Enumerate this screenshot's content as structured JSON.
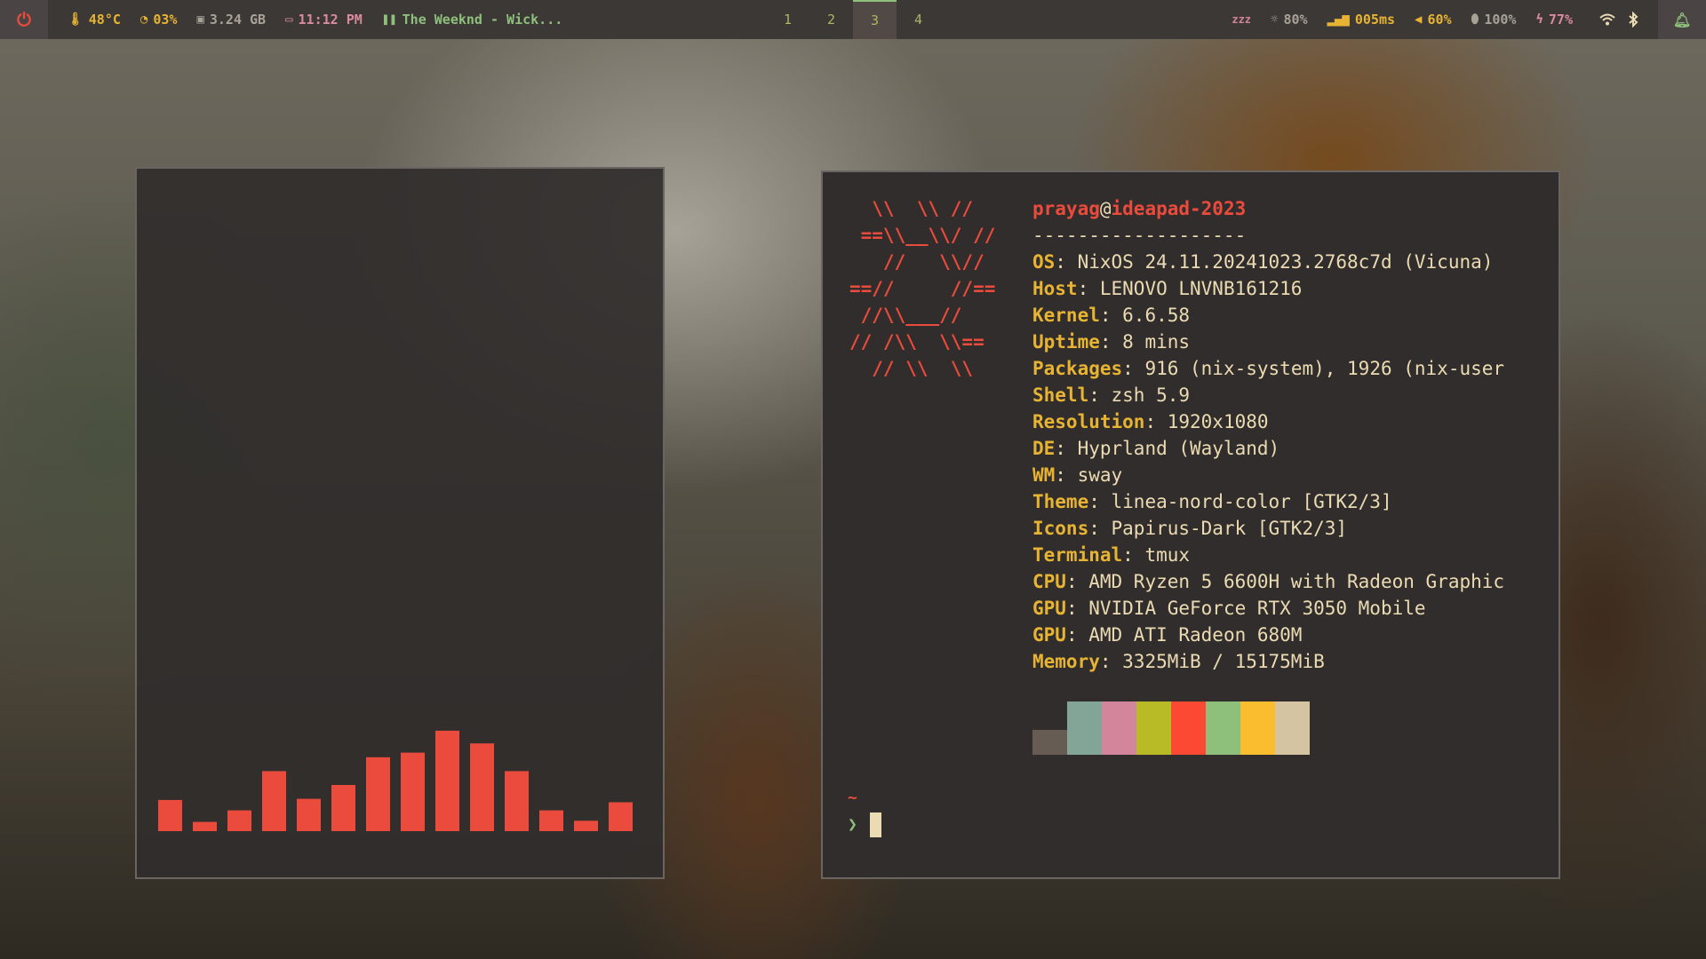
{
  "bar": {
    "temperature": "48°C",
    "cpu_usage": "03%",
    "memory": "3.24 GB",
    "clock": "11:12 PM",
    "media": "The Weeknd - Wick...",
    "workspaces": [
      "1",
      "2",
      "3",
      "4"
    ],
    "active_workspace": "3",
    "idle_icon": "zzz",
    "brightness": "80%",
    "ping": "005ms",
    "volume": "60%",
    "mouse_battery": "100%",
    "battery": "77%"
  },
  "visualizer": {
    "levels": [
      0.27,
      0.08,
      0.18,
      0.52,
      0.28,
      0.4,
      0.64,
      0.68,
      0.87,
      0.76,
      0.52,
      0.18,
      0.09,
      0.25
    ],
    "bar_color": "#ea4b3c"
  },
  "terminal": {
    "logo_lines": [
      "  \\\\  \\\\ //",
      " ==\\\\__\\\\/ //",
      "   //   \\\\//",
      "==//     //==",
      " //\\\\___//",
      "// /\\\\  \\\\==",
      "  // \\\\  \\\\"
    ],
    "user": "prayag",
    "at": "@",
    "host": "ideapad-2023",
    "separator": "-------------------",
    "info": [
      {
        "key": "OS",
        "value": "NixOS 24.11.20241023.2768c7d (Vicuna)"
      },
      {
        "key": "Host",
        "value": "LENOVO LNVNB161216"
      },
      {
        "key": "Kernel",
        "value": "6.6.58"
      },
      {
        "key": "Uptime",
        "value": "8 mins"
      },
      {
        "key": "Packages",
        "value": "916 (nix-system), 1926 (nix-user"
      },
      {
        "key": "Shell",
        "value": "zsh 5.9"
      },
      {
        "key": "Resolution",
        "value": "1920x1080"
      },
      {
        "key": "DE",
        "value": "Hyprland (Wayland)"
      },
      {
        "key": "WM",
        "value": "sway"
      },
      {
        "key": "Theme",
        "value": "linea-nord-color [GTK2/3]"
      },
      {
        "key": "Icons",
        "value": "Papirus-Dark [GTK2/3]"
      },
      {
        "key": "Terminal",
        "value": "tmux"
      },
      {
        "key": "CPU",
        "value": "AMD Ryzen 5 6600H with Radeon Graphic"
      },
      {
        "key": "GPU",
        "value": "NVIDIA GeForce RTX 3050 Mobile"
      },
      {
        "key": "GPU",
        "value": "AMD ATI Radeon 680M"
      },
      {
        "key": "Memory",
        "value": "3325MiB / 15175MiB"
      }
    ],
    "palette": [
      "#665c54",
      "#83a598",
      "#d3869b",
      "#b8bb26",
      "#fb4934",
      "#8ec07c",
      "#fabd2f",
      "#d5c4a1"
    ],
    "prompt_dir": "~",
    "prompt_symbol": "❯"
  }
}
